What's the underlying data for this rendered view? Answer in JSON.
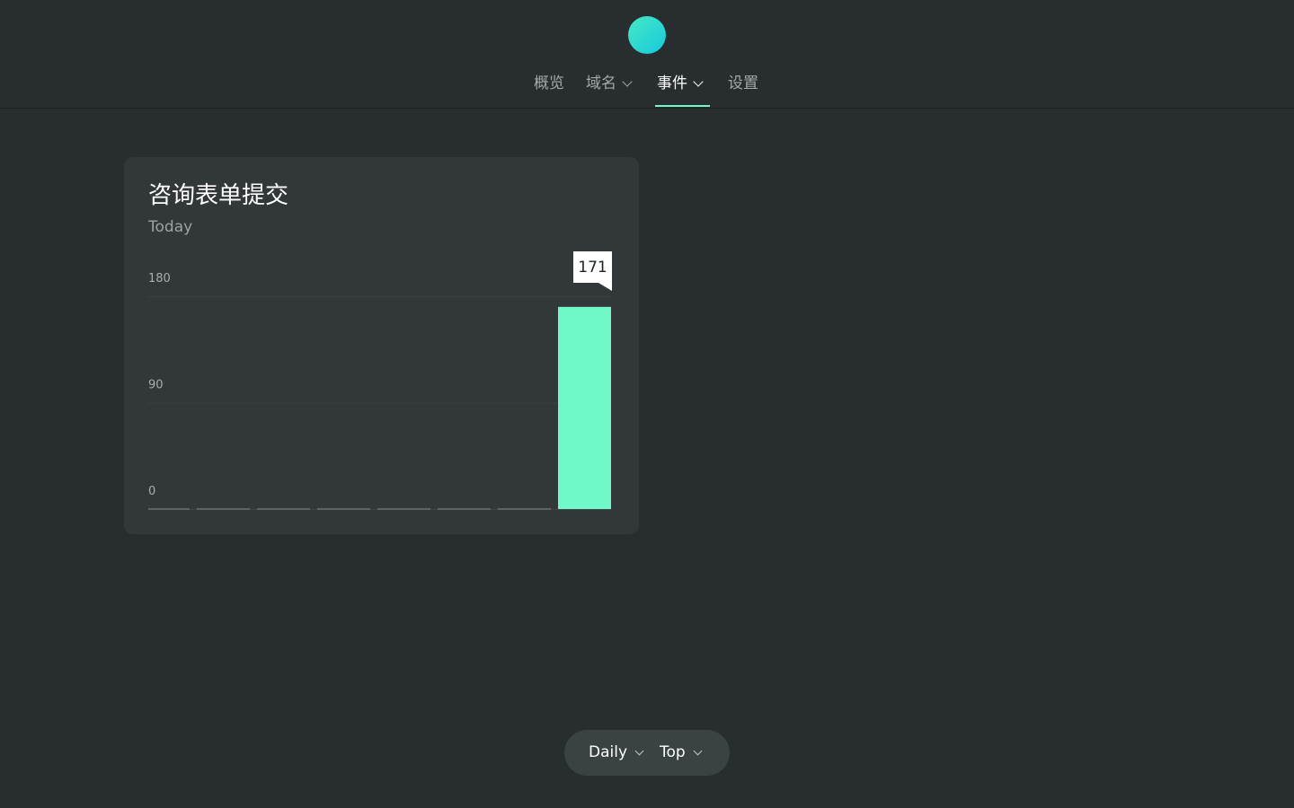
{
  "nav": {
    "items": [
      {
        "label": "概览",
        "has_dropdown": false,
        "active": false
      },
      {
        "label": "域名",
        "has_dropdown": true,
        "active": false
      },
      {
        "label": "事件",
        "has_dropdown": true,
        "active": true
      },
      {
        "label": "设置",
        "has_dropdown": false,
        "active": false
      }
    ]
  },
  "card": {
    "title": "咨询表单提交",
    "subtitle": "Today"
  },
  "controls": {
    "period_label": "Daily",
    "sort_label": "Top"
  },
  "colors": {
    "background": "#282e2f",
    "card": "#323839",
    "accent": "#71f8c9",
    "logo_start": "#45e9c4",
    "logo_end": "#17c9dd"
  },
  "chart_data": {
    "type": "bar",
    "categories": [
      "",
      "",
      "",
      "",
      "",
      "",
      "",
      ""
    ],
    "values": [
      0,
      0,
      0,
      0,
      0,
      0,
      0,
      171
    ],
    "yticks": [
      0,
      90,
      180
    ],
    "ylim": [
      0,
      180
    ],
    "highlight_label": "171",
    "grid": true
  }
}
